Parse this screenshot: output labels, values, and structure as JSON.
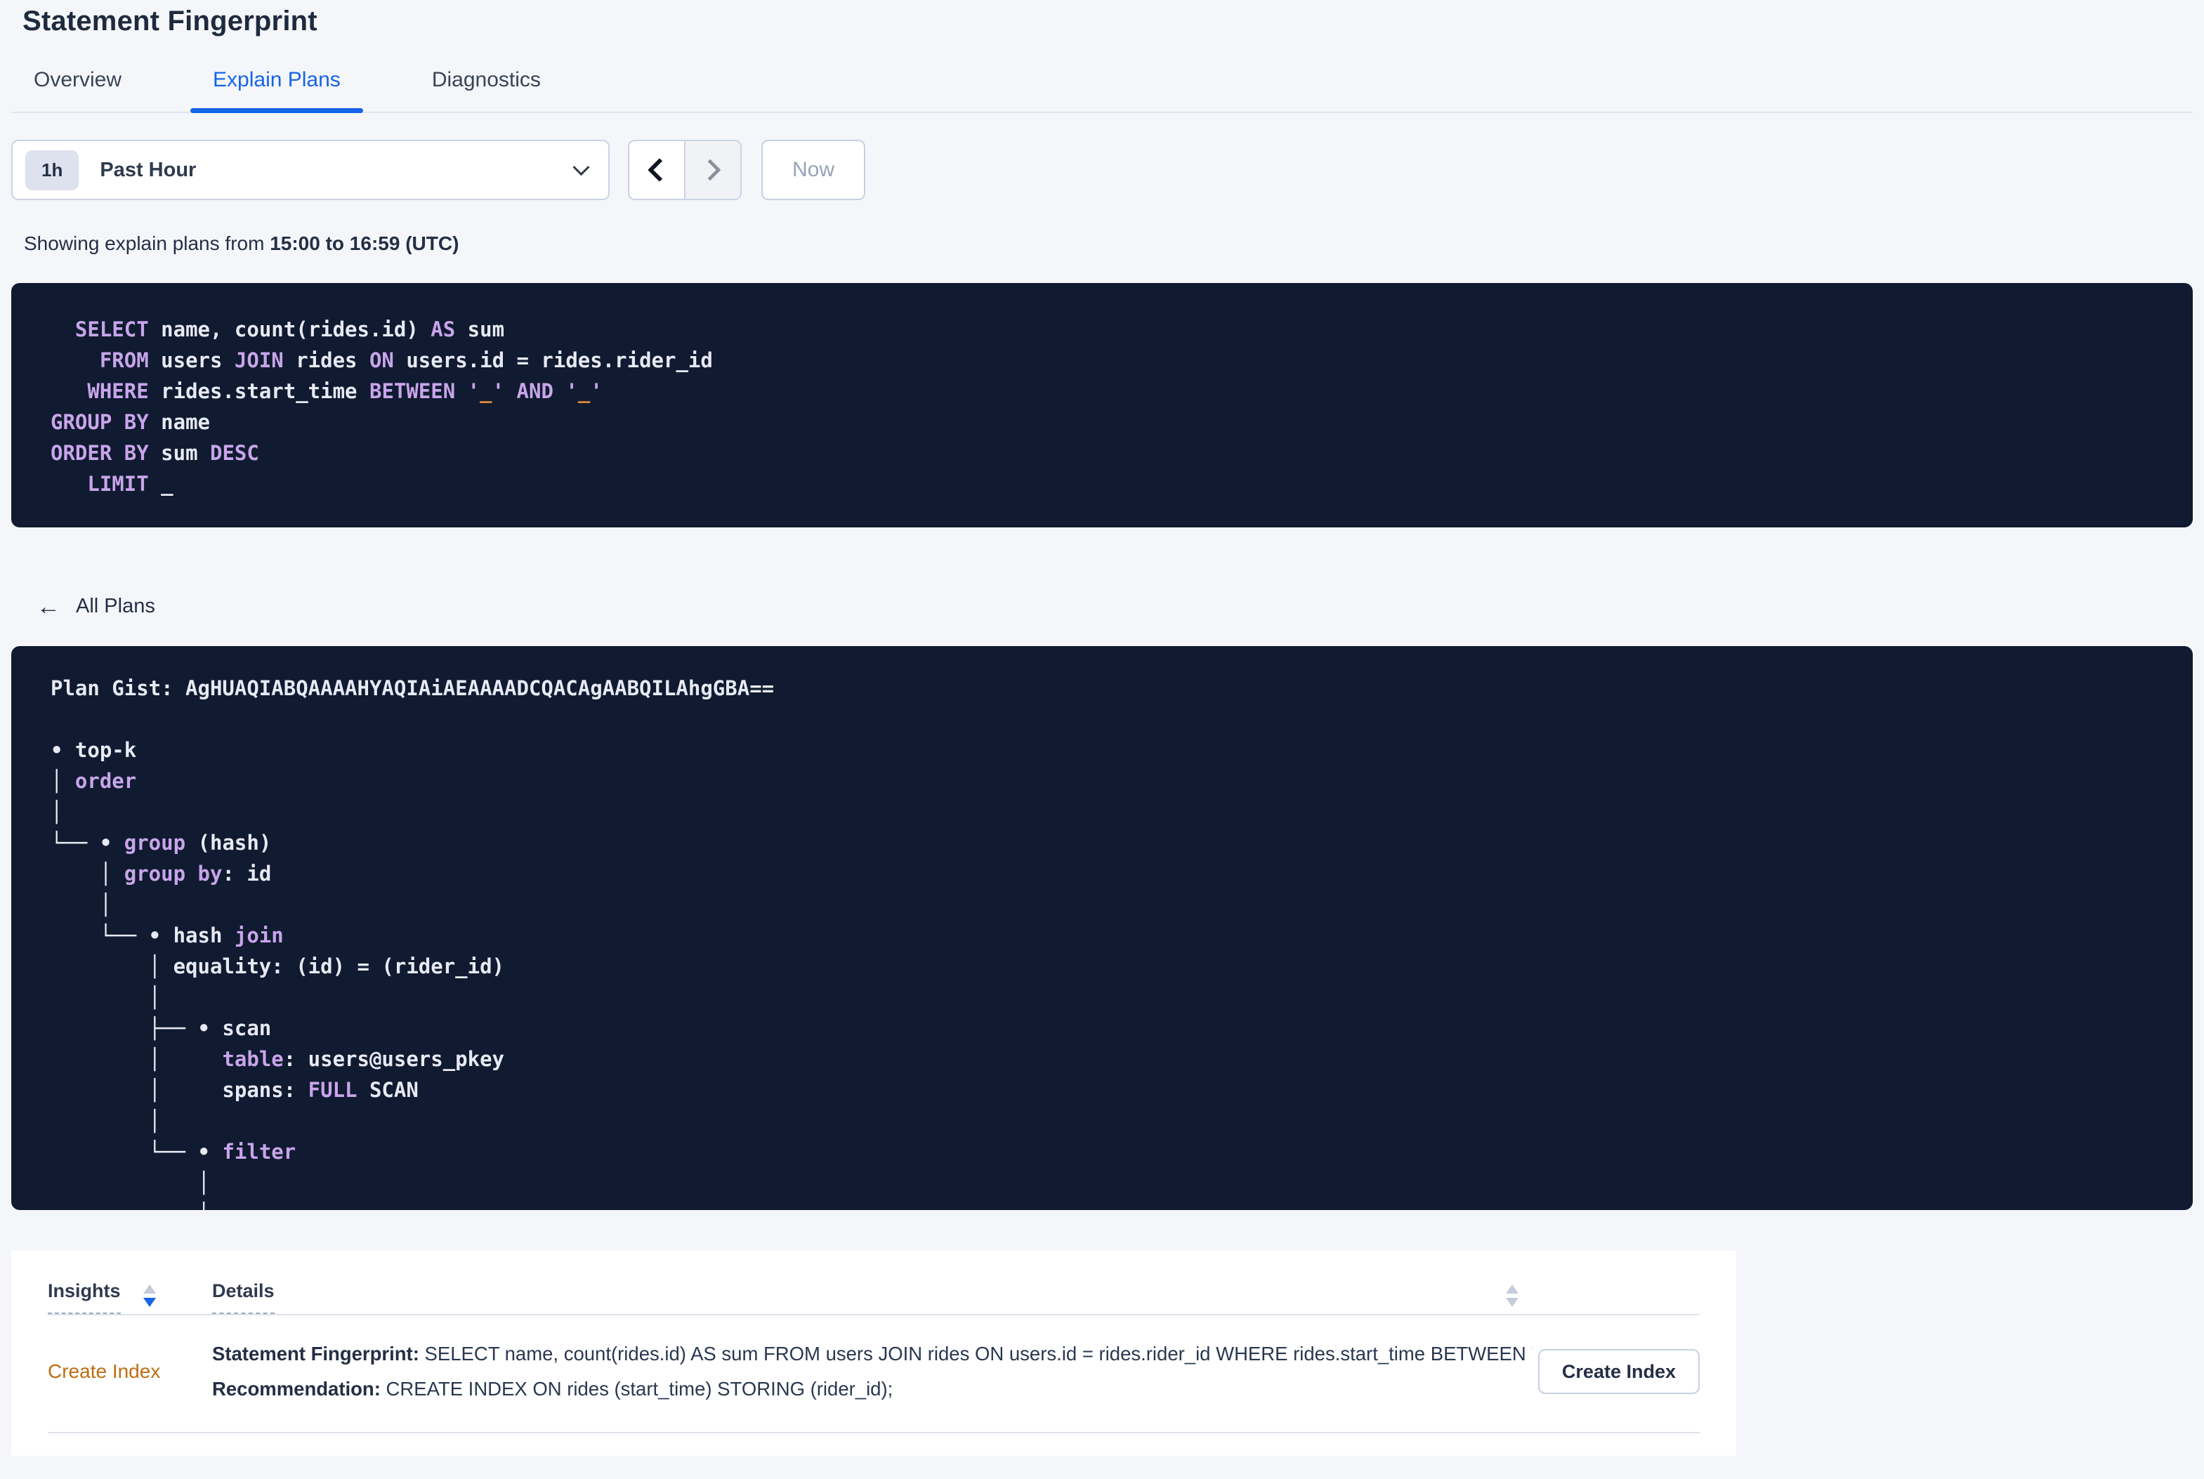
{
  "page": {
    "title": "Statement Fingerprint"
  },
  "tabs": [
    {
      "label": "Overview"
    },
    {
      "label": "Explain Plans"
    },
    {
      "label": "Diagnostics"
    }
  ],
  "time_picker": {
    "badge": "1h",
    "label": "Past Hour",
    "now_label": "Now"
  },
  "showing": {
    "prefix": "Showing explain plans from ",
    "range": "15:00 to 16:59 (UTC)"
  },
  "sql_block": {
    "lines": [
      [
        {
          "c": "pl",
          "v": "  "
        },
        {
          "c": "kw",
          "v": "SELECT"
        },
        {
          "c": "pl",
          "v": " name, count(rides.id) "
        },
        {
          "c": "kw",
          "v": "AS"
        },
        {
          "c": "pl",
          "v": " sum"
        }
      ],
      [
        {
          "c": "pl",
          "v": "    "
        },
        {
          "c": "kw",
          "v": "FROM"
        },
        {
          "c": "pl",
          "v": " users "
        },
        {
          "c": "kw",
          "v": "JOIN"
        },
        {
          "c": "pl",
          "v": " rides "
        },
        {
          "c": "kw",
          "v": "ON"
        },
        {
          "c": "pl",
          "v": " users.id = rides.rider_id"
        }
      ],
      [
        {
          "c": "pl",
          "v": "   "
        },
        {
          "c": "kw",
          "v": "WHERE"
        },
        {
          "c": "pl",
          "v": " rides.start_time "
        },
        {
          "c": "kw",
          "v": "BETWEEN"
        },
        {
          "c": "pl",
          "v": " "
        },
        {
          "c": "q",
          "v": "'"
        },
        {
          "c": "or",
          "v": "_"
        },
        {
          "c": "q",
          "v": "'"
        },
        {
          "c": "pl",
          "v": " "
        },
        {
          "c": "kw",
          "v": "AND"
        },
        {
          "c": "pl",
          "v": " "
        },
        {
          "c": "q",
          "v": "'"
        },
        {
          "c": "or",
          "v": "_"
        },
        {
          "c": "q",
          "v": "'"
        }
      ],
      [
        {
          "c": "kw",
          "v": "GROUP BY"
        },
        {
          "c": "pl",
          "v": " name"
        }
      ],
      [
        {
          "c": "kw",
          "v": "ORDER BY"
        },
        {
          "c": "pl",
          "v": " sum "
        },
        {
          "c": "kw",
          "v": "DESC"
        }
      ],
      [
        {
          "c": "pl",
          "v": "   "
        },
        {
          "c": "kw",
          "v": "LIMIT"
        },
        {
          "c": "pl",
          "v": " _"
        }
      ]
    ]
  },
  "all_plans_label": "All Plans",
  "gist_block": {
    "title": "Plan Gist: AgHUAQIABQAAAAHYAQIAiAEAAAADCQACAgAABQILAhgGBA==",
    "tree": [
      [
        {
          "c": "pl",
          "v": "• top-k"
        }
      ],
      [
        {
          "c": "pl",
          "v": "│ "
        },
        {
          "c": "kw",
          "v": "order"
        }
      ],
      [
        {
          "c": "pl",
          "v": "│"
        }
      ],
      [
        {
          "c": "pl",
          "v": "└── • "
        },
        {
          "c": "kw",
          "v": "group"
        },
        {
          "c": "pl",
          "v": " (hash)"
        }
      ],
      [
        {
          "c": "pl",
          "v": "    │ "
        },
        {
          "c": "kw",
          "v": "group by"
        },
        {
          "c": "pl",
          "v": ": id"
        }
      ],
      [
        {
          "c": "pl",
          "v": "    │"
        }
      ],
      [
        {
          "c": "pl",
          "v": "    └── • hash "
        },
        {
          "c": "kw",
          "v": "join"
        }
      ],
      [
        {
          "c": "pl",
          "v": "        │ equality: (id) = (rider_id)"
        }
      ],
      [
        {
          "c": "pl",
          "v": "        │"
        }
      ],
      [
        {
          "c": "pl",
          "v": "        ├── • scan"
        }
      ],
      [
        {
          "c": "pl",
          "v": "        │     "
        },
        {
          "c": "kw",
          "v": "table"
        },
        {
          "c": "pl",
          "v": ": users@users_pkey"
        }
      ],
      [
        {
          "c": "pl",
          "v": "        │     spans: "
        },
        {
          "c": "kw",
          "v": "FULL"
        },
        {
          "c": "pl",
          "v": " SCAN"
        }
      ],
      [
        {
          "c": "pl",
          "v": "        │"
        }
      ],
      [
        {
          "c": "pl",
          "v": "        └── • "
        },
        {
          "c": "kw",
          "v": "filter"
        }
      ],
      [
        {
          "c": "pl",
          "v": "            │"
        }
      ],
      [
        {
          "c": "pl",
          "v": "            │"
        }
      ]
    ]
  },
  "insights_table": {
    "columns": [
      {
        "label": "Insights",
        "sort": "desc"
      },
      {
        "label": "Details",
        "sort": "none"
      }
    ],
    "rows": [
      {
        "insight": "Create Index",
        "details": [
          {
            "label": "Statement Fingerprint:",
            "text": " SELECT name, count(rides.id) AS sum FROM users JOIN rides ON users.id = rides.rider_id WHERE rides.start_time BETWEEN '_…"
          },
          {
            "label": "Recommendation:",
            "text": " CREATE INDEX ON rides (start_time) STORING (rider_id);"
          }
        ],
        "action_label": "Create Index"
      }
    ]
  },
  "colors": {
    "accent_blue": "#1664E8",
    "code_background": "#101A30",
    "keyword_purple": "#C8A5EA",
    "placeholder_orange": "#E2873B",
    "insight_orange": "#BE6D11",
    "page_background": "#F4F6FA"
  }
}
